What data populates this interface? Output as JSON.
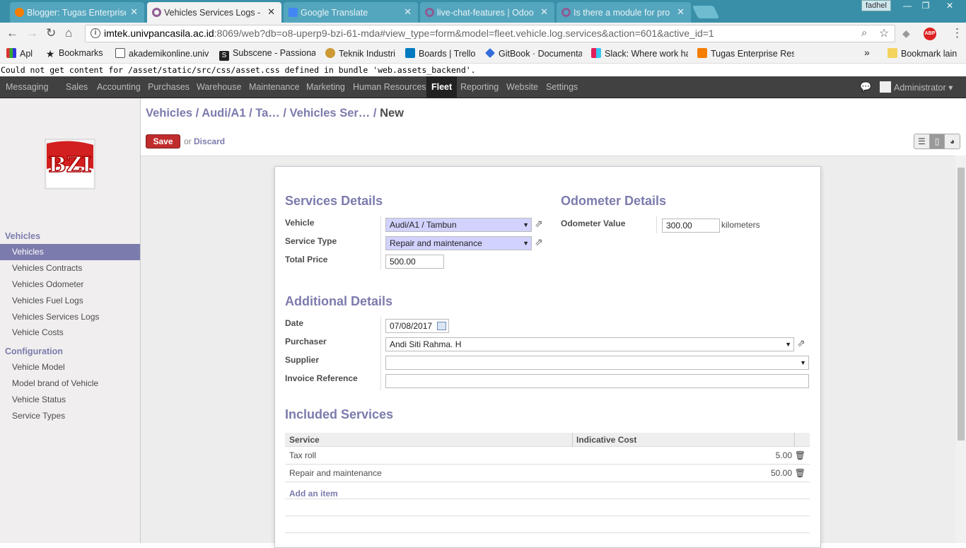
{
  "browser": {
    "tabs": [
      {
        "title": "Blogger: Tugas Enterprise",
        "icon": "blogger-icon",
        "active": false
      },
      {
        "title": "Vehicles Services Logs - Odoo",
        "icon": "odoo-icon",
        "active": true
      },
      {
        "title": "Google Translate",
        "icon": "google-translate-icon",
        "active": false
      },
      {
        "title": "live-chat-features | Odoo",
        "icon": "odoo-icon",
        "active": false
      },
      {
        "title": "Is there a module for pro",
        "icon": "odoo-icon",
        "active": false
      }
    ],
    "profile_name": "fadhel",
    "url_host": "imtek.univpancasila.ac.id",
    "url_rest": ":8069/web?db=o8-uperp9-bzi-61-mda#view_type=form&model=fleet.vehicle.log.services&action=601&active_id=1",
    "bookmarks": [
      {
        "label": "Apl"
      },
      {
        "label": "Bookmarks"
      },
      {
        "label": "akademikonline.univ"
      },
      {
        "label": "Subscene - Passionat"
      },
      {
        "label": "Teknik Industri"
      },
      {
        "label": "Boards | Trello"
      },
      {
        "label": "GitBook · Documenta"
      },
      {
        "label": "Slack: Where work ha"
      },
      {
        "label": "Tugas Enterprise Reso"
      },
      {
        "label": "Bookmark lain"
      }
    ],
    "overflow": "»"
  },
  "error_message": "Could not get content for /asset/static/src/css/asset.css defined in bundle 'web.assets_backend'.",
  "topmenu": {
    "items": [
      "Messaging",
      "Sales",
      "Accounting",
      "Purchases",
      "Warehouse",
      "Maintenance",
      "Marketing",
      "Human Resources",
      "Fleet",
      "Reporting",
      "Website",
      "Settings"
    ],
    "active": "Fleet",
    "user": "Administrator ▾"
  },
  "sidebar": {
    "sections": [
      {
        "title": "Vehicles",
        "items": [
          "Vehicles",
          "Vehicles Contracts",
          "Vehicles Odometer",
          "Vehicles Fuel Logs",
          "Vehicles Services Logs",
          "Vehicle Costs"
        ]
      },
      {
        "title": "Configuration",
        "items": [
          "Vehicle Model",
          "Model brand of Vehicle",
          "Vehicle Status",
          "Service Types"
        ]
      }
    ],
    "active_item": "Vehicles",
    "logo_text": "BZI"
  },
  "breadcrumb": {
    "path": "Vehicles / Audi/A1 / Ta…  / Vehicles Ser… / ",
    "current": "New"
  },
  "actions": {
    "save": "Save",
    "or": "or",
    "discard": "Discard"
  },
  "form": {
    "services_details": {
      "title": "Services Details",
      "vehicle_label": "Vehicle",
      "vehicle_value": "Audi/A1 / Tambun",
      "service_type_label": "Service Type",
      "service_type_value": "Repair and maintenance",
      "total_price_label": "Total Price",
      "total_price_value": "500.00"
    },
    "odometer_details": {
      "title": "Odometer Details",
      "odometer_label": "Odometer Value",
      "odometer_value": "300.00",
      "unit": "kilometers"
    },
    "additional_details": {
      "title": "Additional Details",
      "date_label": "Date",
      "date_value": "07/08/2017",
      "purchaser_label": "Purchaser",
      "purchaser_value": "Andi Siti Rahma. H",
      "supplier_label": "Supplier",
      "supplier_value": "",
      "invoice_label": "Invoice Reference",
      "invoice_value": ""
    },
    "included_services": {
      "title": "Included Services",
      "columns": [
        "Service",
        "Indicative Cost"
      ],
      "rows": [
        {
          "service": "Tax roll",
          "cost": "5.00"
        },
        {
          "service": "Repair and maintenance",
          "cost": "50.00"
        }
      ],
      "add_item": "Add an item"
    }
  }
}
